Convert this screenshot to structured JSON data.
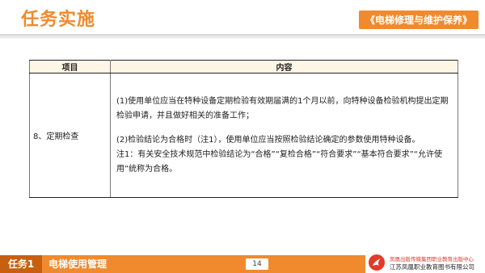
{
  "header": {
    "title": "任务实施",
    "course_title": "《电梯修理与维护保养》"
  },
  "table": {
    "headers": [
      "项目",
      "内容"
    ],
    "row": {
      "item": "8、定期检查",
      "paragraphs": [
        "(1)使用单位应当在特种设备定期检验有效期届满的1个月以前，向特种设备检验机构提出定期检验申请，并且做好相关的准备工作；",
        "(2)检验结论为合格时（注1），使用单位应当按照检验结论确定的参数使用特种设备。",
        "注1：有关安全技术规范中检验结论为“合格”“复检合格”“符合要求”“基本符合要求”“允许使用”统称为合格。"
      ]
    }
  },
  "footer": {
    "task_no": "任务1",
    "task_name": "电梯使用管理",
    "page": "14",
    "publisher_line1": "凤凰出版传媒集团职业教育出版中心",
    "publisher_line2": "江苏凤凰职业教育图书有限公司"
  },
  "colors": {
    "accent": "#f08a2c",
    "accent_dark": "#c75f10",
    "header_fill": "#fff6e6"
  }
}
